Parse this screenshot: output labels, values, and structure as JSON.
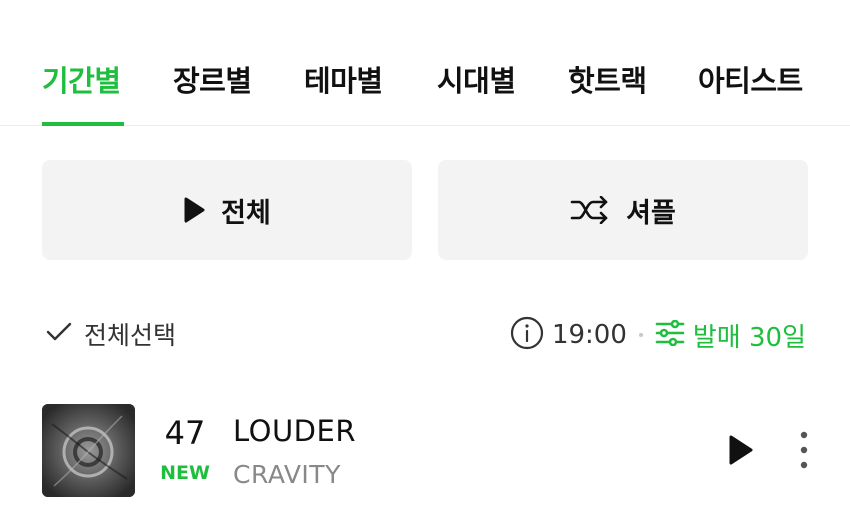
{
  "tabs": [
    {
      "label": "기간별",
      "active": true
    },
    {
      "label": "장르별",
      "active": false
    },
    {
      "label": "테마별",
      "active": false
    },
    {
      "label": "시대별",
      "active": false
    },
    {
      "label": "핫트랙",
      "active": false
    },
    {
      "label": "아티스트",
      "active": false
    }
  ],
  "actions": {
    "play_all_label": "전체",
    "shuffle_label": "셔플"
  },
  "list_header": {
    "select_all_label": "전체선택",
    "time": "19:00",
    "filter_label": "발매 30일"
  },
  "tracks": [
    {
      "rank": "47",
      "badge": "NEW",
      "title": "LOUDER",
      "artist": "CRAVITY"
    }
  ],
  "colors": {
    "accent": "#1fbe3f",
    "button_bg": "#f3f3f3",
    "secondary_text": "#888888"
  },
  "icons": {
    "play": "play-icon",
    "shuffle": "shuffle-icon",
    "check": "check-icon",
    "info": "info-icon",
    "filter": "sliders-icon",
    "more": "more-vertical-icon"
  }
}
